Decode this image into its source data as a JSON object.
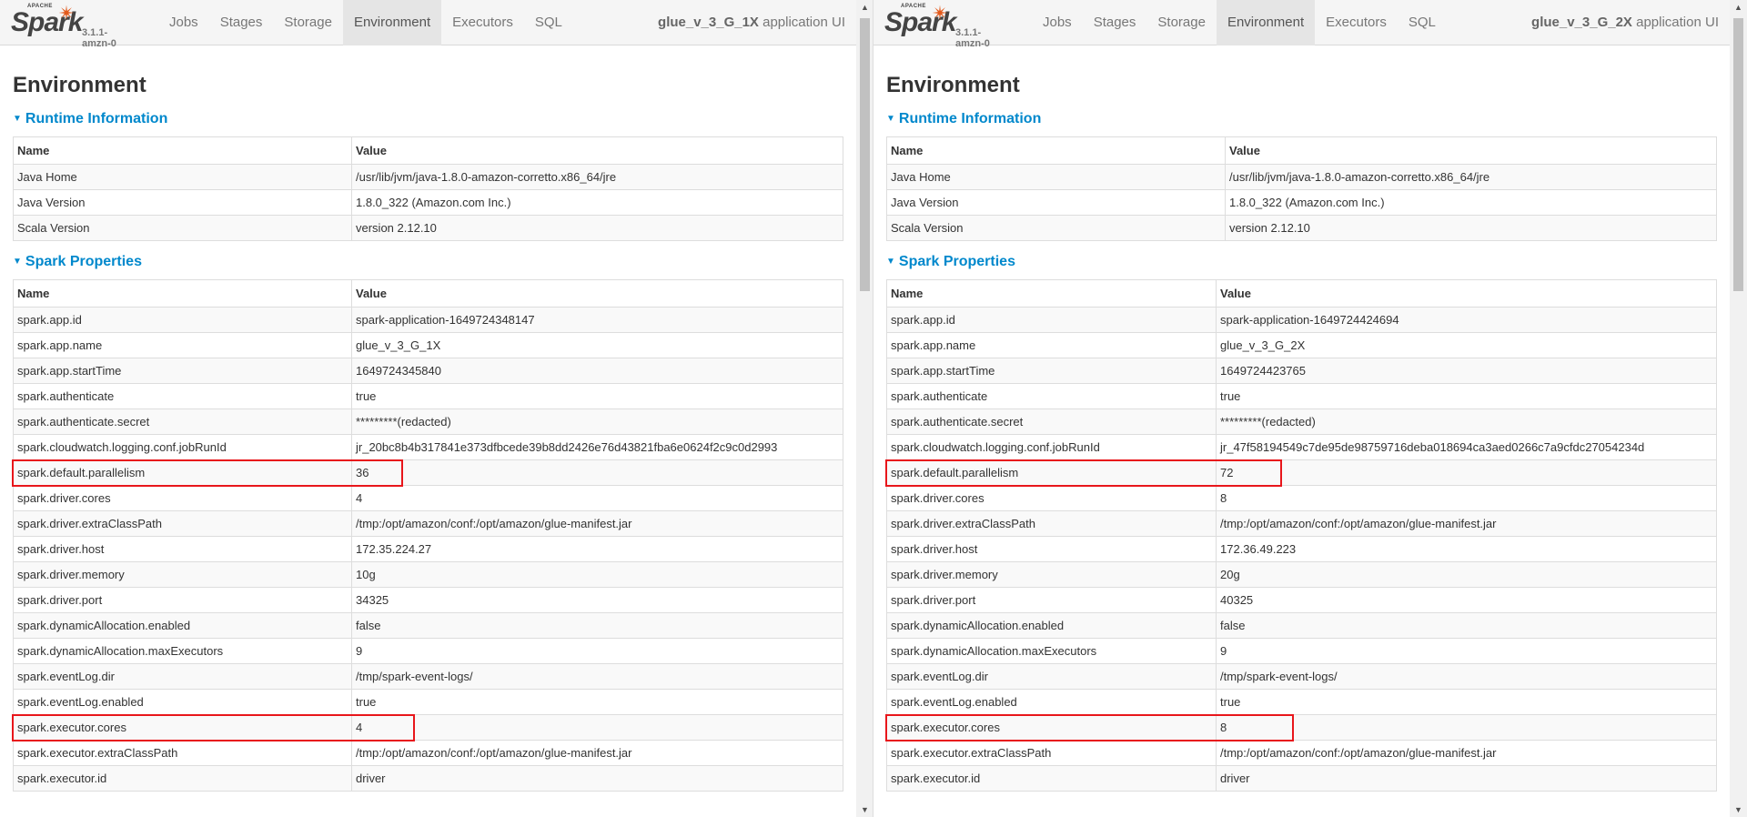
{
  "panes": [
    {
      "brand": {
        "apache": "APACHE",
        "spark": "Spark",
        "version": "3.1.1-amzn-0"
      },
      "nav_tabs": [
        "Jobs",
        "Stages",
        "Storage",
        "Environment",
        "Executors",
        "SQL"
      ],
      "active_tab": "Environment",
      "app_name": "glue_v_3_G_1X",
      "app_suffix": " application UI",
      "page_title": "Environment",
      "runtime": {
        "title": "Runtime Information",
        "headers": [
          "Name",
          "Value"
        ],
        "rows": [
          [
            "Java Home",
            "/usr/lib/jvm/java-1.8.0-amazon-corretto.x86_64/jre"
          ],
          [
            "Java Version",
            "1.8.0_322 (Amazon.com Inc.)"
          ],
          [
            "Scala Version",
            "version 2.12.10"
          ]
        ]
      },
      "spark_props": {
        "title": "Spark Properties",
        "headers": [
          "Name",
          "Value"
        ],
        "rows": [
          [
            "spark.app.id",
            "spark-application-1649724348147"
          ],
          [
            "spark.app.name",
            "glue_v_3_G_1X"
          ],
          [
            "spark.app.startTime",
            "1649724345840"
          ],
          [
            "spark.authenticate",
            "true"
          ],
          [
            "spark.authenticate.secret",
            "*********(redacted)"
          ],
          [
            "spark.cloudwatch.logging.conf.jobRunId",
            "jr_20bc8b4b317841e373dfbcede39b8dd2426e76d43821fba6e0624f2c9c0d2993"
          ],
          [
            "spark.default.parallelism",
            "36"
          ],
          [
            "spark.driver.cores",
            "4"
          ],
          [
            "spark.driver.extraClassPath",
            "/tmp:/opt/amazon/conf:/opt/amazon/glue-manifest.jar"
          ],
          [
            "spark.driver.host",
            "172.35.224.27"
          ],
          [
            "spark.driver.memory",
            "10g"
          ],
          [
            "spark.driver.port",
            "34325"
          ],
          [
            "spark.dynamicAllocation.enabled",
            "false"
          ],
          [
            "spark.dynamicAllocation.maxExecutors",
            "9"
          ],
          [
            "spark.eventLog.dir",
            "/tmp/spark-event-logs/"
          ],
          [
            "spark.eventLog.enabled",
            "true"
          ],
          [
            "spark.executor.cores",
            "4"
          ],
          [
            "spark.executor.extraClassPath",
            "/tmp:/opt/amazon/conf:/opt/amazon/glue-manifest.jar"
          ],
          [
            "spark.executor.id",
            "driver"
          ]
        ],
        "highlighted_rows": [
          6,
          16
        ]
      }
    },
    {
      "brand": {
        "apache": "APACHE",
        "spark": "Spark",
        "version": "3.1.1-amzn-0"
      },
      "nav_tabs": [
        "Jobs",
        "Stages",
        "Storage",
        "Environment",
        "Executors",
        "SQL"
      ],
      "active_tab": "Environment",
      "app_name": "glue_v_3_G_2X",
      "app_suffix": " application UI",
      "page_title": "Environment",
      "runtime": {
        "title": "Runtime Information",
        "headers": [
          "Name",
          "Value"
        ],
        "rows": [
          [
            "Java Home",
            "/usr/lib/jvm/java-1.8.0-amazon-corretto.x86_64/jre"
          ],
          [
            "Java Version",
            "1.8.0_322 (Amazon.com Inc.)"
          ],
          [
            "Scala Version",
            "version 2.12.10"
          ]
        ]
      },
      "spark_props": {
        "title": "Spark Properties",
        "headers": [
          "Name",
          "Value"
        ],
        "rows": [
          [
            "spark.app.id",
            "spark-application-1649724424694"
          ],
          [
            "spark.app.name",
            "glue_v_3_G_2X"
          ],
          [
            "spark.app.startTime",
            "1649724423765"
          ],
          [
            "spark.authenticate",
            "true"
          ],
          [
            "spark.authenticate.secret",
            "*********(redacted)"
          ],
          [
            "spark.cloudwatch.logging.conf.jobRunId",
            "jr_47f58194549c7de95de98759716deba018694ca3aed0266c7a9cfdc27054234d"
          ],
          [
            "spark.default.parallelism",
            "72"
          ],
          [
            "spark.driver.cores",
            "8"
          ],
          [
            "spark.driver.extraClassPath",
            "/tmp:/opt/amazon/conf:/opt/amazon/glue-manifest.jar"
          ],
          [
            "spark.driver.host",
            "172.36.49.223"
          ],
          [
            "spark.driver.memory",
            "20g"
          ],
          [
            "spark.driver.port",
            "40325"
          ],
          [
            "spark.dynamicAllocation.enabled",
            "false"
          ],
          [
            "spark.dynamicAllocation.maxExecutors",
            "9"
          ],
          [
            "spark.eventLog.dir",
            "/tmp/spark-event-logs/"
          ],
          [
            "spark.eventLog.enabled",
            "true"
          ],
          [
            "spark.executor.cores",
            "8"
          ],
          [
            "spark.executor.extraClassPath",
            "/tmp:/opt/amazon/conf:/opt/amazon/glue-manifest.jar"
          ],
          [
            "spark.executor.id",
            "driver"
          ]
        ],
        "highlighted_rows": [
          6,
          16
        ]
      }
    }
  ],
  "colors": {
    "accent": "#0088cc",
    "highlight": "#e8161b",
    "spark_star": "#e25a1c"
  }
}
